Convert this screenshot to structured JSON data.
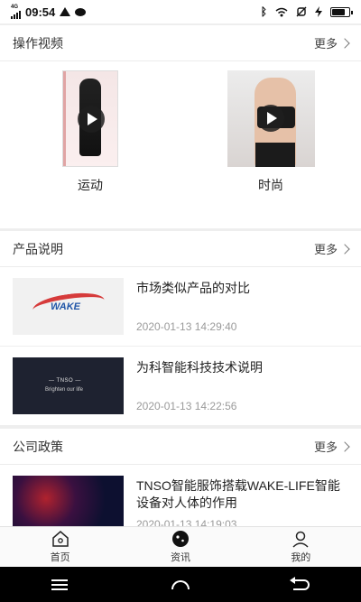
{
  "status_bar": {
    "network": "4G",
    "time": "09:54",
    "battery_level": 0.85,
    "icons": [
      "signal-icon",
      "warning-icon",
      "message-icon",
      "bluetooth-icon",
      "wifi-icon",
      "mute-icon",
      "charging-icon",
      "battery-icon"
    ]
  },
  "videos_section": {
    "title": "操作视频",
    "more_label": "更多",
    "items": [
      {
        "label": "运动"
      },
      {
        "label": "时尚"
      }
    ]
  },
  "product_section": {
    "title": "产品说明",
    "more_label": "更多",
    "items": [
      {
        "title": "市场类似产品的对比",
        "date": "2020-01-13 14:29:40",
        "thumb_text": "WAKE"
      },
      {
        "title": "为科智能科技技术说明",
        "date": "2020-01-13 14:22:56",
        "thumb_text": "Brighten our life"
      }
    ]
  },
  "policy_section": {
    "title": "公司政策",
    "more_label": "更多",
    "items": [
      {
        "title": "TNSO智能服饰搭载WAKE-LIFE智能设备对人体的作用",
        "date": "2020-01-13 14:19:03"
      }
    ]
  },
  "tabbar": {
    "tabs": [
      {
        "label": "首页",
        "icon": "home-icon"
      },
      {
        "label": "资讯",
        "icon": "news-icon"
      },
      {
        "label": "我的",
        "icon": "profile-icon"
      }
    ]
  },
  "colors": {
    "brand_red": "#d63b3b",
    "brand_blue": "#2357a8",
    "background": "#eeeeee"
  }
}
